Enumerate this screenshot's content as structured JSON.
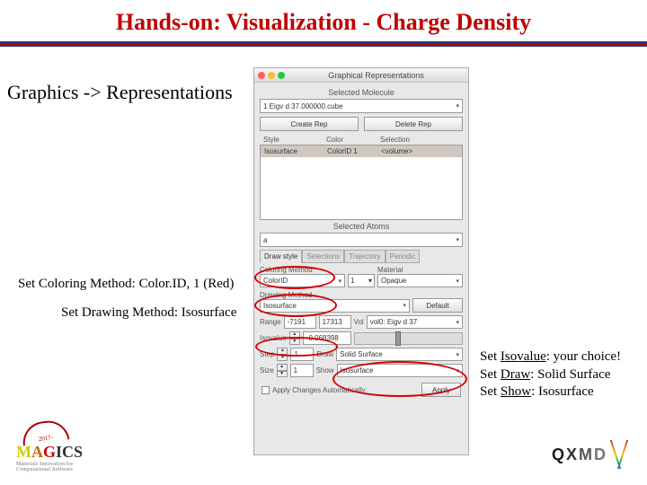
{
  "slide": {
    "title": "Hands-on: Visualization - Charge Density",
    "nav": "Graphics -> Representations",
    "instr_color": "Set Coloring Method: Color.ID, 1 (Red)",
    "instr_draw": "Set Drawing Method: Isosurface",
    "instr_right": {
      "line1_prefix": "Set ",
      "line1_key": "Isovalue",
      "line1_suffix": ": your choice!",
      "line2_prefix": "Set ",
      "line2_key": "Draw",
      "line2_suffix": ": Solid Surface",
      "line3_prefix": "Set ",
      "line3_key": "Show",
      "line3_suffix": ": Isosurface"
    }
  },
  "dialog": {
    "title": "Graphical Representations",
    "selected_molecule_label": "Selected Molecule",
    "selected_molecule_value": "1  Eigv d 37.000000.cube",
    "create_rep": "Create Rep",
    "delete_rep": "Delete Rep",
    "col_style": "Style",
    "col_color": "Color",
    "col_selection": "Selection",
    "row_style": "Isosurface",
    "row_color": "ColorID 1",
    "row_selection": "<volume>",
    "selected_atoms_label": "Selected Atoms",
    "selected_atoms_value": "a",
    "tabs": {
      "drawstyle": "Draw style",
      "selections": "Selections",
      "trajectory": "Trajectory",
      "periodic": "Periodic"
    },
    "coloring_method_label": "Coloring Method",
    "coloring_method_value": "ColorID",
    "color_id_value": "1",
    "material_label": "Material",
    "material_value": "Opaque",
    "drawing_method_label": "Drawing Method",
    "drawing_method_value": "Isosurface",
    "default_btn": "Default",
    "range_label": "Range",
    "range_min": "-7191",
    "range_max": "17313",
    "vol_label": "Vol",
    "vol_value": "vol0: Eigv d 37",
    "isovalue_label": "Isovalue",
    "isovalue_value": "-0.068398",
    "step_label": "Step",
    "step_value": "1",
    "draw_label": "Draw",
    "draw_value": "Solid Surface",
    "size_label": "Size",
    "size_value": "1",
    "show_label": "Show",
    "show_value": "Isosurface",
    "apply_auto": "Apply Changes Automatically",
    "apply_btn": "Apply"
  },
  "logos": {
    "magics_year": "2017-",
    "magics_name": "MAGICS",
    "magics_sub": "Materials Innovation for Computational Software",
    "qxmd": "QXMD"
  }
}
